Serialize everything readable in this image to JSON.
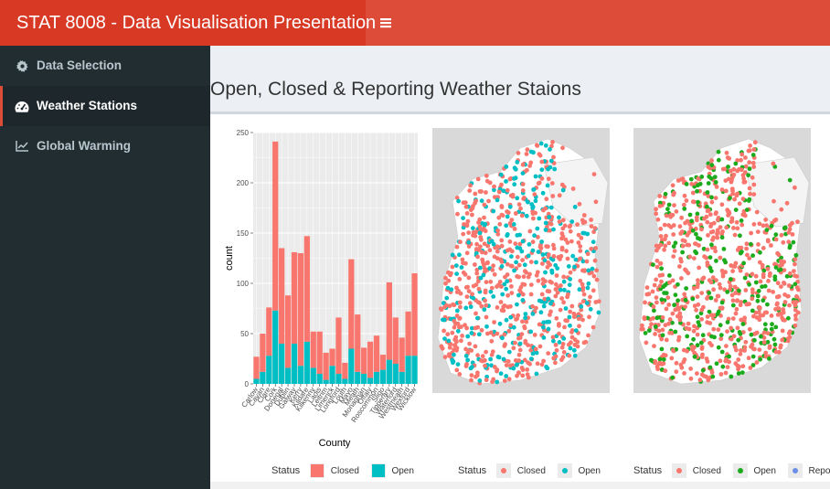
{
  "header": {
    "brand": "STAT 8008 - Data Visualisation Presentation",
    "toggle_icon": "hamburger-icon"
  },
  "sidebar": {
    "items": [
      {
        "label": "Data Selection",
        "icon": "gear-icon",
        "active": false
      },
      {
        "label": "Weather Stations",
        "icon": "dashboard-icon",
        "active": true
      },
      {
        "label": "Global Warming",
        "icon": "line-chart-icon",
        "active": false
      }
    ]
  },
  "main": {
    "title": "Open, Closed & Reporting Weather Staions"
  },
  "colors": {
    "closed": "#f8766d",
    "open": "#00bfc4",
    "open_green": "#1cab1c",
    "report": "#6b8fe8",
    "map_bg": "#d9d9d9"
  },
  "chart_data": [
    {
      "type": "bar",
      "stacked": true,
      "xlabel": "County",
      "ylabel": "count",
      "ylim": [
        0,
        250
      ],
      "yticks": [
        0,
        50,
        100,
        150,
        200,
        250
      ],
      "categories": [
        "Carlow",
        "Cavan",
        "Clare",
        "Cork",
        "Donegal",
        "Dublin",
        "Galway",
        "Kerry",
        "Kildare",
        "Kilkenny",
        "Laois",
        "Leitrim",
        "Limerick",
        "Longford",
        "Louth",
        "Mayo",
        "Meath",
        "Monaghan",
        "Offaly",
        "Roscommon",
        "Sligo",
        "Tipperary",
        "Waterford",
        "Westmeath",
        "Wexford",
        "Wicklow"
      ],
      "series": [
        {
          "name": "Open",
          "values": [
            5,
            12,
            28,
            73,
            40,
            16,
            40,
            18,
            42,
            16,
            10,
            4,
            18,
            10,
            5,
            35,
            12,
            10,
            6,
            12,
            14,
            24,
            20,
            12,
            28,
            28
          ]
        },
        {
          "name": "Closed",
          "values": [
            22,
            38,
            48,
            168,
            95,
            72,
            91,
            112,
            105,
            36,
            42,
            27,
            17,
            56,
            16,
            89,
            57,
            26,
            36,
            36,
            15,
            77,
            46,
            34,
            44,
            82
          ]
        }
      ],
      "legend": {
        "title": "Status",
        "entries": [
          "Closed",
          "Open"
        ],
        "position": "bottom"
      },
      "grid": true
    },
    {
      "type": "scatter",
      "description_type": "map",
      "series": [
        {
          "name": "Closed"
        },
        {
          "name": "Open"
        }
      ],
      "legend": {
        "title": "Status",
        "entries": [
          "Closed",
          "Open"
        ],
        "position": "bottom"
      }
    },
    {
      "type": "scatter",
      "description_type": "map",
      "series": [
        {
          "name": "Closed"
        },
        {
          "name": "Open"
        },
        {
          "name": "Report"
        }
      ],
      "legend": {
        "title": "Status",
        "entries": [
          "Closed",
          "Open",
          "Report"
        ],
        "position": "bottom"
      }
    }
  ]
}
